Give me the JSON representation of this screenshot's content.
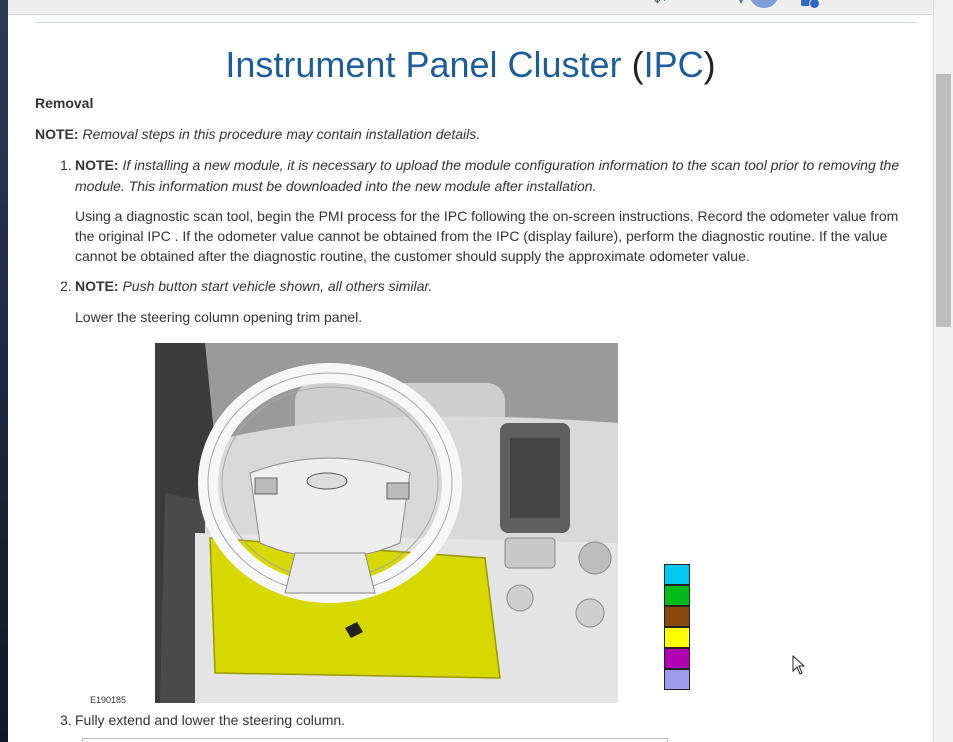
{
  "toolbar": {
    "back_icon": "back-arrow-icon",
    "dropdown_icon": "chevron-down-icon",
    "avatar_icon": "user-avatar-icon",
    "profile_icon": "profile-settings-icon"
  },
  "page": {
    "title_main": "Instrument Panel Cluster ",
    "title_open": "(",
    "title_abbr": "IPC",
    "title_close": ")"
  },
  "section": {
    "heading": "Removal",
    "note_label": "NOTE:",
    "note_text": "Removal steps in this procedure may contain installation details."
  },
  "steps": [
    {
      "number": "1.",
      "note_label": "NOTE:",
      "note_line1": "If installing a new module, it is necessary to upload the module configuration information to the scan tool prior to removing the",
      "note_line2": "module. This information must be downloaded into the new module after installation.",
      "body_line1": "Using a diagnostic scan tool, begin the PMI process for the IPC following the on-screen instructions. Record the odometer value from",
      "body_line2": "the original IPC . If the odometer value cannot be obtained from the IPC (display failure), perform the diagnostic routine. If the value",
      "body_line3": "cannot be obtained after the diagnostic routine, the customer should supply the approximate odometer value."
    },
    {
      "number": "2.",
      "note_label": "NOTE:",
      "note_text": "Push button start vehicle shown, all others similar.",
      "body": "Lower the steering column opening trim panel."
    },
    {
      "number": "3.",
      "body": "Fully extend and lower the steering column."
    }
  ],
  "figure": {
    "id": "E190185",
    "highlight_color": "#d7d800"
  },
  "legend_swatches": [
    "#00c8ee",
    "#00bb1a",
    "#8a4a0c",
    "#ffff00",
    "#b400b4",
    "#a09aee"
  ],
  "cursor_icon": "mouse-pointer-icon"
}
